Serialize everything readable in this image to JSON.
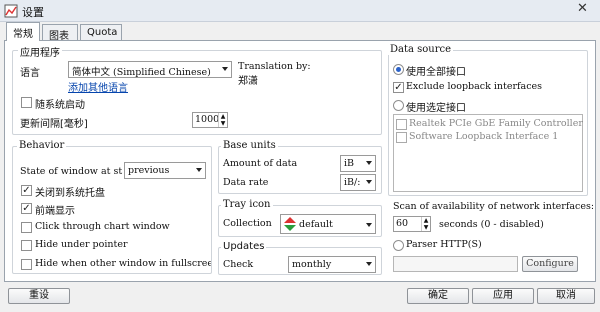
{
  "window": {
    "title": "设置",
    "close_glyph": "✕"
  },
  "tabs": [
    {
      "label": "常规",
      "active": true
    },
    {
      "label": "图表",
      "active": false
    },
    {
      "label": "Quota",
      "active": false
    }
  ],
  "app": {
    "group_title": "应用程序",
    "language_label": "语言",
    "language_value": "简体中文 (Simplified Chinese)",
    "translation_by_label": "Translation by:",
    "translator": "郑潇",
    "add_language_link": "添加其他语言",
    "autostart_label": "随系统启动",
    "autostart_checked": false,
    "update_interval_label": "更新间隔[毫秒]",
    "update_interval_value": "1000"
  },
  "behavior": {
    "group_title": "Behavior",
    "state_label": "State of window at st",
    "state_value": "previous",
    "options": [
      {
        "label": "关闭到系统托盘",
        "checked": true
      },
      {
        "label": "前端显示",
        "checked": true
      },
      {
        "label": "Click through chart window",
        "checked": false
      },
      {
        "label": "Hide under pointer",
        "checked": false
      },
      {
        "label": "Hide when other window in fullscreen m",
        "checked": false
      }
    ]
  },
  "base_units": {
    "group_title": "Base units",
    "amount_label": "Amount of data",
    "amount_value": "iB",
    "rate_label": "Data rate",
    "rate_value": "iB/:"
  },
  "tray_icon": {
    "group_title": "Tray icon",
    "collection_label": "Collection",
    "collection_value": "default"
  },
  "updates": {
    "group_title": "Updates",
    "check_label": "Check",
    "check_value": "monthly"
  },
  "data_source": {
    "group_title": "Data source",
    "all_interfaces_label": "使用全部接口",
    "exclude_loopback_label": "Exclude loopback interfaces",
    "exclude_loopback_checked": true,
    "selected_interfaces_label": "使用选定接口",
    "interfaces": [
      {
        "label": "Realtek PCIe GbE Family Controller",
        "checked": false
      },
      {
        "label": "Software Loopback Interface 1",
        "checked": false
      }
    ],
    "scan_label": "Scan of availability of network interfaces:",
    "scan_value": "60",
    "scan_suffix": "seconds (0 - disabled)",
    "parser_label": "Parser HTTP(S)",
    "configure_label": "Configure"
  },
  "footer": {
    "reset_label": "重设",
    "ok_label": "确定",
    "apply_label": "应用",
    "cancel_label": "取消"
  }
}
